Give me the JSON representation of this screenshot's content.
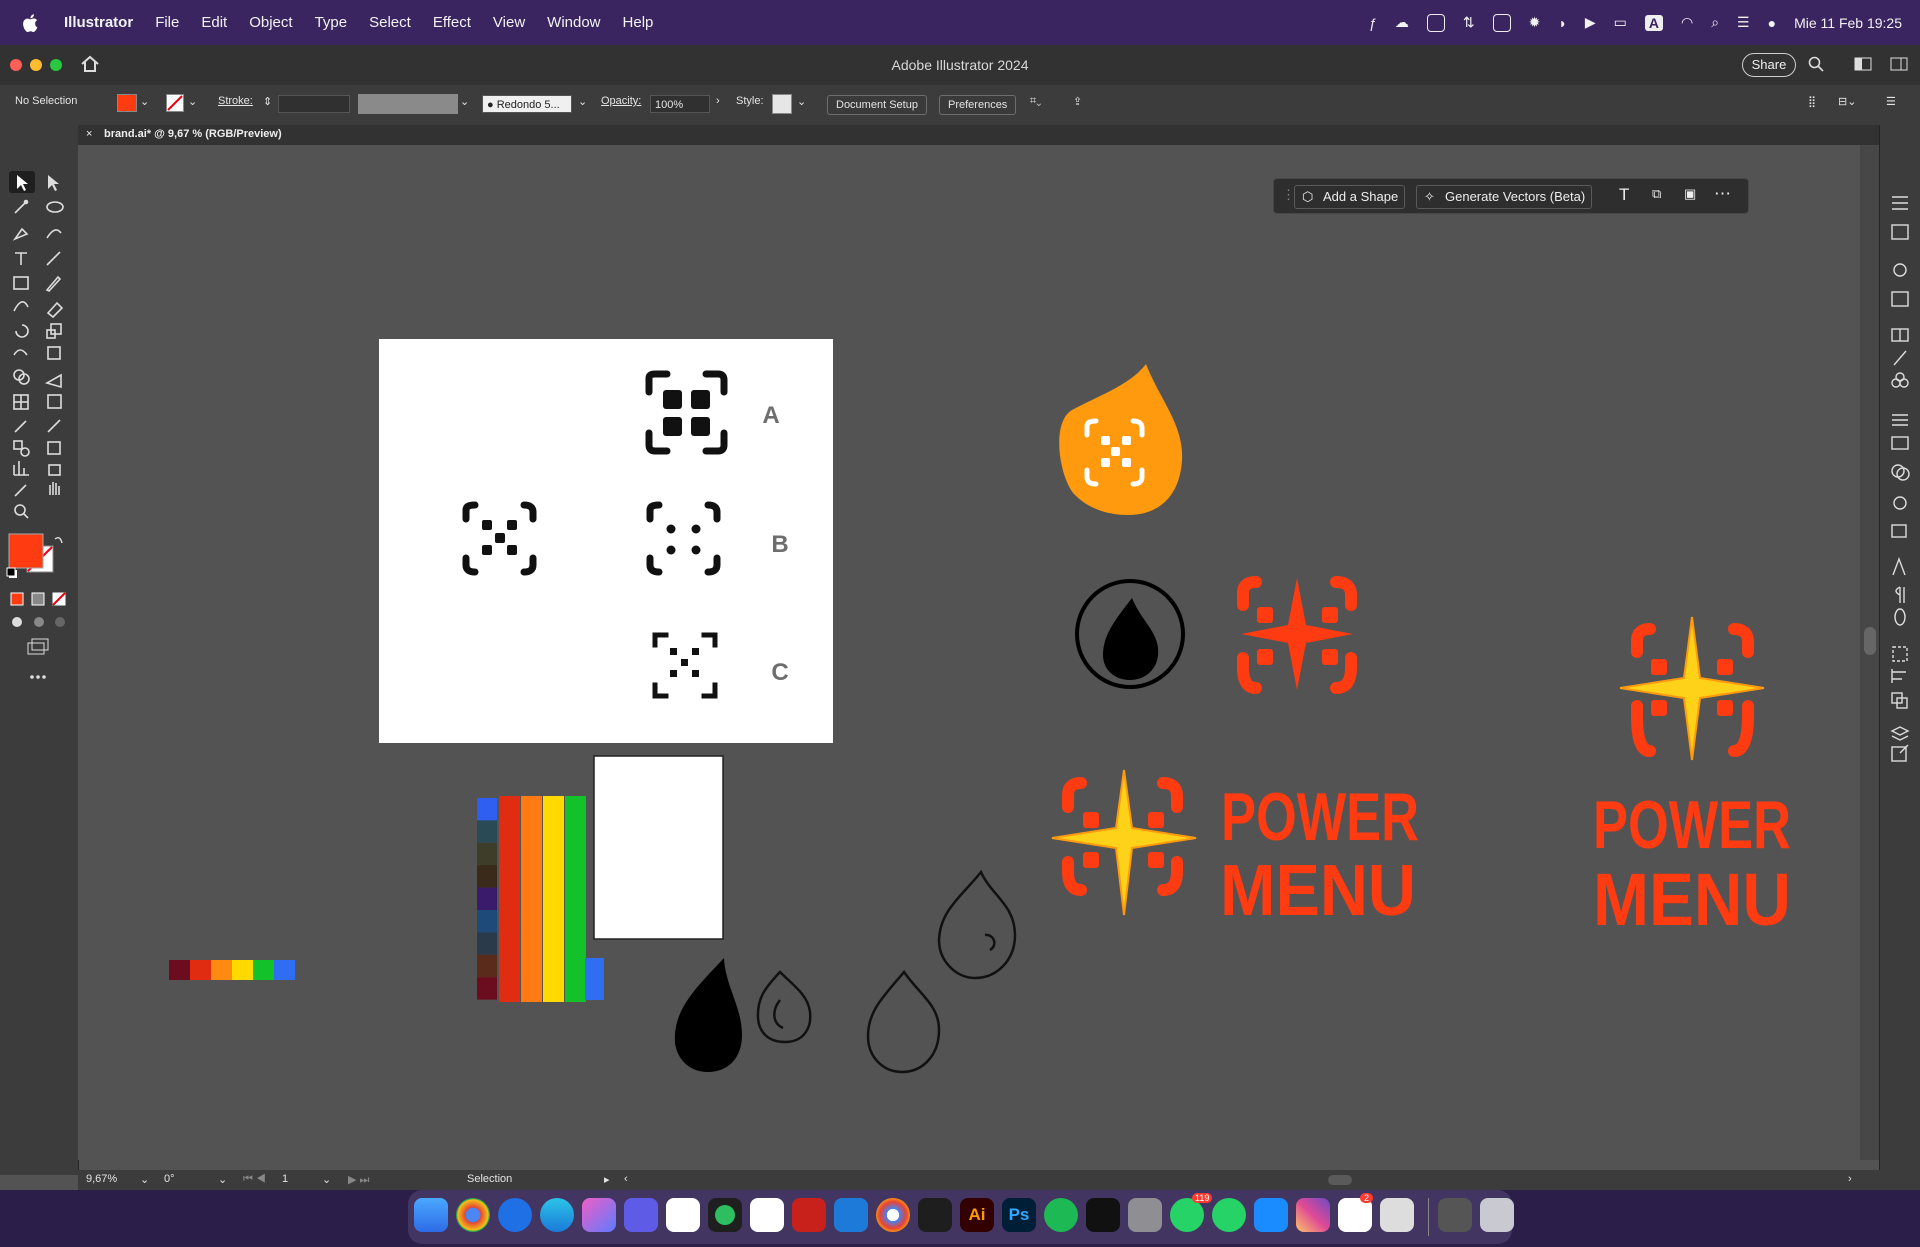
{
  "menubar": {
    "app_name": "Illustrator",
    "items": [
      "File",
      "Edit",
      "Object",
      "Type",
      "Select",
      "Effect",
      "View",
      "Window",
      "Help"
    ],
    "input_indicator": "A",
    "datetime": "Mie 11 Feb  19:25"
  },
  "window": {
    "title": "Adobe Illustrator 2024",
    "share_label": "Share"
  },
  "control_bar": {
    "selection_label": "No Selection",
    "stroke_label": "Stroke:",
    "brush_label": "Redondo 5...",
    "opacity_label": "Opacity:",
    "opacity_value": "100%",
    "style_label": "Style:",
    "document_setup_label": "Document Setup",
    "preferences_label": "Preferences",
    "fill_color": "#ff3b12"
  },
  "document_tab": {
    "label": "brand.ai* @ 9,67 % (RGB/Preview)"
  },
  "contextual_bar": {
    "add_shape_label": "Add a Shape",
    "generate_vectors_label": "Generate Vectors (Beta)"
  },
  "artboard": {
    "labels": [
      "A",
      "B",
      "C"
    ]
  },
  "artwork": {
    "power_word1": "POWER",
    "power_word2": "MENU",
    "primary_color": "#ff3b12",
    "orange_color": "#ff9a0f",
    "star_color": "#ffd21a"
  },
  "swatches": {
    "strip_colors": [
      "#6b0d1f",
      "#e02d12",
      "#ff8a12",
      "#ffd900",
      "#13c22b",
      "#2f6ef2"
    ],
    "column_colors": [
      "#2f5ff0",
      "#2a4a55",
      "#3d3d2a",
      "#3a2a1a",
      "#3a1a6a",
      "#1e4a7a",
      "#2a3a4a",
      "#5a2a1a",
      "#6b0d1f"
    ],
    "stripe_colors": [
      "#e02d12",
      "#ff7a12",
      "#ffd900",
      "#13c22b"
    ]
  },
  "status_bar": {
    "zoom": "9,67%",
    "rotation": "0°",
    "artboard_number": "1",
    "tool_name": "Selection"
  },
  "dock": {
    "whatsapp_badge": "119",
    "notes_badge": "2"
  }
}
